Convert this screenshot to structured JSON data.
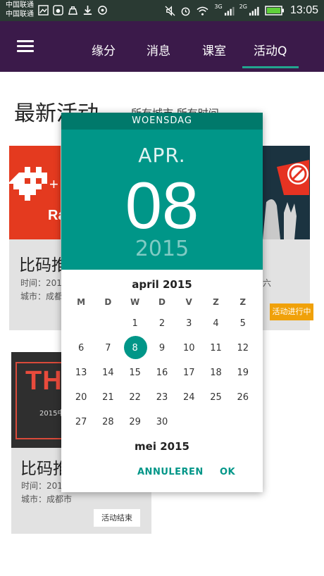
{
  "status_bar": {
    "carriers": [
      "中国联通",
      "中国联通"
    ],
    "network": [
      "3G",
      "2G"
    ],
    "time": "13:05"
  },
  "nav": {
    "tabs": [
      "缘分",
      "消息",
      "课室",
      "活动Q"
    ],
    "active_tab_index": 3
  },
  "page": {
    "title": "最新活动",
    "filter": "所有城市  所有时间"
  },
  "cards": [
    {
      "title": "比码推",
      "time_label": "时间：201",
      "city_label": "城市：成都",
      "right_text": "六",
      "badge": "活动进行中"
    },
    {
      "title": "比码推",
      "time_label": "时间：201",
      "city_label": "城市：成都市",
      "badge": "活动结束",
      "image_text": "THAC",
      "image_sub": "2015中"
    }
  ],
  "date_picker": {
    "weekday": "WOENSDAG",
    "month": "APR.",
    "day": "08",
    "year": "2015",
    "calendar_title": "april 2015",
    "weekday_labels": [
      "M",
      "D",
      "W",
      "D",
      "V",
      "Z",
      "Z"
    ],
    "weeks": [
      [
        "",
        "",
        "1",
        "2",
        "3",
        "4",
        "5"
      ],
      [
        "6",
        "7",
        "8",
        "9",
        "10",
        "11",
        "12"
      ],
      [
        "13",
        "14",
        "15",
        "16",
        "17",
        "18",
        "19"
      ],
      [
        "20",
        "21",
        "22",
        "23",
        "24",
        "25",
        "26"
      ],
      [
        "27",
        "28",
        "29",
        "30",
        "",
        "",
        ""
      ]
    ],
    "selected_day": "8",
    "next_month": "mei 2015",
    "cancel_label": "ANNULEREN",
    "ok_label": "OK",
    "accent_color": "#009688"
  }
}
